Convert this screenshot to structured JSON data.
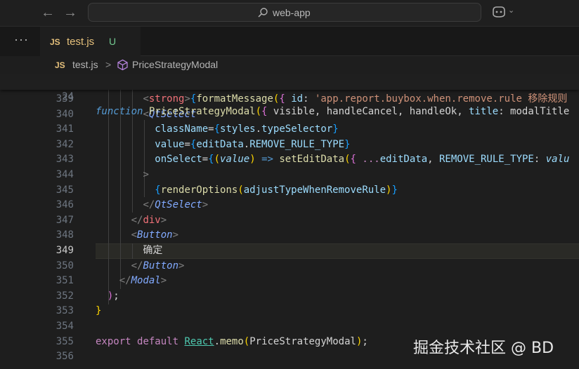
{
  "titlebar": {
    "back_icon": "arrow-left-icon",
    "forward_icon": "arrow-right-icon",
    "search_text": "web-app",
    "copilot_icon": "copilot-icon"
  },
  "tabbar": {
    "more_label": "···",
    "tab": {
      "lang": "JS",
      "name": "test.js",
      "status": "U"
    }
  },
  "breadcrumb": {
    "lang": "JS",
    "file": "test.js",
    "separator": ">",
    "symbol": "PriceStrategyModal"
  },
  "editor": {
    "current_line": "349",
    "sticky_line": {
      "num": "24",
      "tokens": [
        [
          "kw",
          "function"
        ],
        [
          "tx",
          " "
        ],
        [
          "fn",
          "PriceStrategyModal"
        ],
        [
          "br",
          "("
        ],
        [
          "br2",
          "{"
        ],
        [
          "tx",
          " visible, handleCancel, handleOk, "
        ],
        [
          "pl",
          "title"
        ],
        [
          "tx",
          ": modalTitle"
        ]
      ]
    },
    "lines": [
      {
        "num": "339",
        "tokens": [
          [
            "tx",
            "        "
          ],
          [
            "pn",
            "<"
          ],
          [
            "tg",
            "strong"
          ],
          [
            "pn",
            ">"
          ],
          [
            "br3",
            "{"
          ],
          [
            "fn",
            "formatMessage"
          ],
          [
            "br",
            "("
          ],
          [
            "br2",
            "{"
          ],
          [
            "tx",
            " "
          ],
          [
            "pl",
            "id"
          ],
          [
            "tx",
            ": "
          ],
          [
            "st",
            "'app.report.buybox.when.remove.rule 移除规则"
          ]
        ]
      },
      {
        "num": "340",
        "tokens": [
          [
            "tx",
            "        "
          ],
          [
            "pn",
            "<"
          ],
          [
            "cp",
            "QtSelect"
          ]
        ]
      },
      {
        "num": "341",
        "tokens": [
          [
            "tx",
            "          "
          ],
          [
            "pl",
            "className"
          ],
          [
            "op",
            "="
          ],
          [
            "br3",
            "{"
          ],
          [
            "pl",
            "styles"
          ],
          [
            "tx",
            "."
          ],
          [
            "pl",
            "typeSelector"
          ],
          [
            "br3",
            "}"
          ]
        ]
      },
      {
        "num": "342",
        "tokens": [
          [
            "tx",
            "          "
          ],
          [
            "pl",
            "value"
          ],
          [
            "op",
            "="
          ],
          [
            "br3",
            "{"
          ],
          [
            "pl",
            "editData"
          ],
          [
            "tx",
            "."
          ],
          [
            "pl",
            "REMOVE_RULE_TYPE"
          ],
          [
            "br3",
            "}"
          ]
        ]
      },
      {
        "num": "343",
        "tokens": [
          [
            "tx",
            "          "
          ],
          [
            "pl",
            "onSelect"
          ],
          [
            "op",
            "="
          ],
          [
            "br3",
            "{"
          ],
          [
            "br",
            "("
          ],
          [
            "pt",
            "value"
          ],
          [
            "br",
            ")"
          ],
          [
            "tx",
            " "
          ],
          [
            "kw",
            "=>"
          ],
          [
            "tx",
            " "
          ],
          [
            "fn",
            "setEditData"
          ],
          [
            "br",
            "("
          ],
          [
            "br2",
            "{"
          ],
          [
            "tx",
            " "
          ],
          [
            "kw2",
            "..."
          ],
          [
            "pl",
            "editData"
          ],
          [
            "tx",
            ", "
          ],
          [
            "pl",
            "REMOVE_RULE_TYPE"
          ],
          [
            "tx",
            ": "
          ],
          [
            "pt",
            "valu"
          ]
        ]
      },
      {
        "num": "344",
        "tokens": [
          [
            "tx",
            "        "
          ],
          [
            "pn",
            ">"
          ]
        ]
      },
      {
        "num": "345",
        "tokens": [
          [
            "tx",
            "          "
          ],
          [
            "br3",
            "{"
          ],
          [
            "fn",
            "renderOptions"
          ],
          [
            "br",
            "("
          ],
          [
            "pl",
            "adjustTypeWhenRemoveRule"
          ],
          [
            "br",
            ")"
          ],
          [
            "br3",
            "}"
          ]
        ]
      },
      {
        "num": "346",
        "tokens": [
          [
            "tx",
            "        "
          ],
          [
            "pn",
            "</"
          ],
          [
            "cp",
            "QtSelect"
          ],
          [
            "pn",
            ">"
          ]
        ]
      },
      {
        "num": "347",
        "tokens": [
          [
            "tx",
            "      "
          ],
          [
            "pn",
            "</"
          ],
          [
            "tg",
            "div"
          ],
          [
            "pn",
            ">"
          ]
        ]
      },
      {
        "num": "348",
        "tokens": [
          [
            "tx",
            "      "
          ],
          [
            "pn",
            "<"
          ],
          [
            "cp",
            "Button"
          ],
          [
            "pn",
            ">"
          ]
        ]
      },
      {
        "num": "349",
        "tokens": [
          [
            "tx",
            "        确定"
          ]
        ]
      },
      {
        "num": "350",
        "tokens": [
          [
            "tx",
            "      "
          ],
          [
            "pn",
            "</"
          ],
          [
            "cp",
            "Button"
          ],
          [
            "pn",
            ">"
          ]
        ]
      },
      {
        "num": "351",
        "tokens": [
          [
            "tx",
            "    "
          ],
          [
            "pn",
            "</"
          ],
          [
            "cp",
            "Modal"
          ],
          [
            "pn",
            ">"
          ]
        ]
      },
      {
        "num": "352",
        "tokens": [
          [
            "tx",
            "  "
          ],
          [
            "br2",
            ")"
          ],
          [
            "tx",
            ";"
          ]
        ]
      },
      {
        "num": "353",
        "tokens": [
          [
            "br",
            "}"
          ]
        ]
      },
      {
        "num": "354",
        "tokens": []
      },
      {
        "num": "355",
        "tokens": [
          [
            "kw2",
            "export"
          ],
          [
            "tx",
            " "
          ],
          [
            "kw2",
            "default"
          ],
          [
            "tx",
            " "
          ],
          [
            "cls und",
            "React"
          ],
          [
            "tx",
            "."
          ],
          [
            "fn",
            "memo"
          ],
          [
            "br",
            "("
          ],
          [
            "tx",
            "PriceStrategyModal"
          ],
          [
            "br",
            ")"
          ],
          [
            "tx",
            ";"
          ]
        ]
      },
      {
        "num": "356",
        "tokens": []
      }
    ]
  },
  "watermark": "掘金技术社区 @ BD"
}
